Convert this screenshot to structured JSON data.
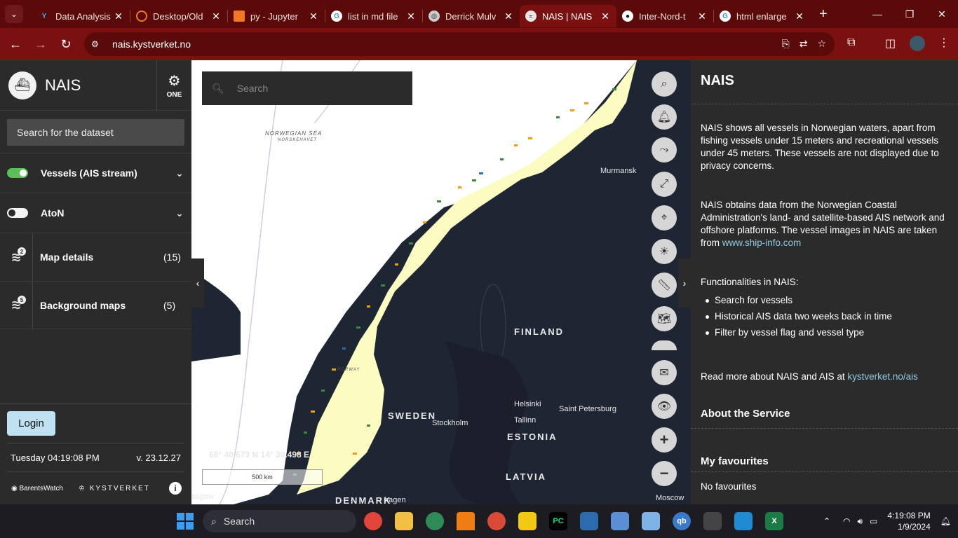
{
  "browser": {
    "tabs": [
      {
        "label": "Data Analysis",
        "icon": "data-analysis-favicon",
        "active": false
      },
      {
        "label": "Desktop/Old",
        "icon": "jupyter-favicon",
        "active": false
      },
      {
        "label": "py - Jupyter",
        "icon": "notebook-favicon",
        "active": false
      },
      {
        "label": "list in md file",
        "icon": "google-favicon",
        "active": false
      },
      {
        "label": "Derrick Mulv",
        "icon": "globe-favicon",
        "active": false
      },
      {
        "label": "NAIS | NAIS",
        "icon": "nais-favicon",
        "active": true
      },
      {
        "label": "Inter-Nord-t",
        "icon": "github-favicon",
        "active": false
      },
      {
        "label": "html enlarge",
        "icon": "google-favicon",
        "active": false
      }
    ],
    "tab_close_glyph": "✕",
    "new_tab_glyph": "+",
    "url": "nais.kystverket.no"
  },
  "left_panel": {
    "app_title": "NAIS",
    "settings_label": "ONE",
    "dataset_search_placeholder": "Search for the dataset",
    "layers": [
      {
        "name": "Vessels (AIS stream)",
        "enabled": true
      },
      {
        "name": "AtoN",
        "enabled": false
      }
    ],
    "details": [
      {
        "name": "Map details",
        "badge": "2",
        "count": "(15)"
      },
      {
        "name": "Background maps",
        "badge": "5",
        "count": "(5)"
      }
    ],
    "login_label": "Login",
    "datetime": "Tuesday 04:19:08 PM",
    "version": "v. 23.12.27",
    "brand_barentswatch": "BarentsWatch",
    "brand_kystverket": "KYSTVERKET",
    "info_glyph": "i"
  },
  "map": {
    "search_placeholder": "Search",
    "labels": {
      "norwegian_sea": "NORWEGIAN SEA",
      "norwegian_sea_sub": "NORSKEHAVET",
      "murmansk": "Murmansk",
      "finland": "FINLAND",
      "helsinki": "Helsinki",
      "saint_petersburg": "Saint Petersburg",
      "tallinn": "Tallinn",
      "estonia": "ESTONIA",
      "sweden": "SWEDEN",
      "stockholm": "Stockholm",
      "latvia": "LATVIA",
      "denmark": "DENMARK",
      "copenhagen": "hagen",
      "glasgow": "asgow",
      "moscow": "Moscow",
      "norway": "NORWAY"
    },
    "coordinates": "68° 40.673 N 14° 38.498 E",
    "scale_label": "500 km",
    "accent_land": "#fbfbc2",
    "accent_sea": "#ffffff",
    "accent_dark": "#1f2633"
  },
  "right_panel": {
    "title": "NAIS",
    "para1": "NAIS shows all vessels in Norwegian waters, apart from fishing vessels under 15 meters and recreational vessels under 45 meters. These vessels are not displayed due to privacy concerns.",
    "para2_prefix": "NAIS obtains data from the Norwegian Coastal Administration's land- and satellite-based AIS network and offshore platforms. The vessel images in NAIS are taken from ",
    "para2_link": "www.ship-info.com",
    "functionalities_title": "Functionalities in NAIS:",
    "functionalities": [
      "Search for vessels",
      "Historical AIS data two weeks back in time",
      "Filter by vessel flag and vessel type"
    ],
    "read_more_prefix": "Read more about NAIS and AIS at ",
    "read_more_link": "kystverket.no/ais",
    "about_title": "About the Service",
    "favourites_title": "My favourites",
    "favourites_empty": "No favourites"
  },
  "taskbar": {
    "search_label": "Search",
    "time": "4:19:08 PM",
    "date": "1/9/2024",
    "apps": [
      {
        "icon": "chrome-icon",
        "color": "#e0443a"
      },
      {
        "icon": "file-explorer-icon",
        "color": "#f2c144"
      },
      {
        "icon": "chrome-alt-icon",
        "color": "#2e8b57"
      },
      {
        "icon": "vlc-icon",
        "color": "#f07d12"
      },
      {
        "icon": "chrome-active-icon",
        "color": "#d94a38"
      },
      {
        "icon": "power-bi-icon",
        "color": "#f2c811"
      },
      {
        "icon": "pycharm-icon",
        "color": "#21d789"
      },
      {
        "icon": "network-icon",
        "color": "#2b6cb0"
      },
      {
        "icon": "monitor-icon",
        "color": "#5a8fd6"
      },
      {
        "icon": "notepad-icon",
        "color": "#7fb3e8"
      },
      {
        "icon": "qbittorrent-icon",
        "color": "#3a78c9"
      },
      {
        "icon": "terminal-icon",
        "color": "#444"
      },
      {
        "icon": "vscode-icon",
        "color": "#1f8ad2"
      },
      {
        "icon": "excel-icon",
        "color": "#1d7a45"
      }
    ],
    "qb_label": "qb",
    "pc_label": "PC",
    "x_label": "X"
  }
}
